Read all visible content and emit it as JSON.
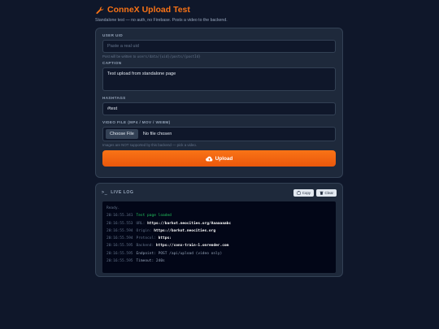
{
  "header": {
    "title": "ConneX Upload Test",
    "subtitle": "Standalone test — no auth, no Firebase. Posts a video to the backend."
  },
  "form": {
    "uid_label": "USER UID",
    "uid_placeholder": "Paste a real uid",
    "uid_hint_prefix": "Post will be written to ",
    "uid_hint_path": "users/data/{uid}/posts/{postId}",
    "caption_label": "CAPTION",
    "caption_value": "Test upload from standalone page",
    "hashtags_label": "HASHTAGS",
    "hashtags_value": "#test",
    "file_label": "VIDEO FILE (MP4 / MOV / WEBM)",
    "file_button": "Choose File",
    "file_status": "No file chosen",
    "file_hint": "Images are NOT supported by this backend — pick a video.",
    "upload_label": "Upload"
  },
  "log": {
    "title": "LIVE LOG",
    "copy_label": "Copy",
    "clear_label": "Clear",
    "ready": "Ready.",
    "lines": [
      {
        "ts": "20:16:55.341",
        "label": "Test page loaded",
        "value": "",
        "kind": "ok"
      },
      {
        "ts": "20:16:55.553",
        "label": "URL:",
        "value": "https://barkot.neocities.org/Aaaaaaabc",
        "kind": "kv"
      },
      {
        "ts": "20:16:55.594",
        "label": "Origin:",
        "value": "https://barkot.neocities.org",
        "kind": "kv"
      },
      {
        "ts": "20:16:55.594",
        "label": "Protocol:",
        "value": "https:",
        "kind": "kv"
      },
      {
        "ts": "20:16:55.595",
        "label": "Backend:",
        "value": "https://conx-train-1.onrender.com",
        "kind": "kv"
      },
      {
        "ts": "20:16:55.595",
        "label": "Endpoint: POST /api/upload (video only)",
        "value": "",
        "kind": "plain"
      },
      {
        "ts": "20:16:55.595",
        "label": "Timeout: 240s",
        "value": "",
        "kind": "plain"
      }
    ]
  },
  "colors": {
    "background": "#0f172a",
    "card": "#1e293b",
    "accent": "#f97316",
    "success": "#22c55e"
  },
  "icons": [
    "wrench-icon",
    "cloud-upload-icon",
    "terminal-icon",
    "clipboard-icon",
    "trash-icon"
  ]
}
